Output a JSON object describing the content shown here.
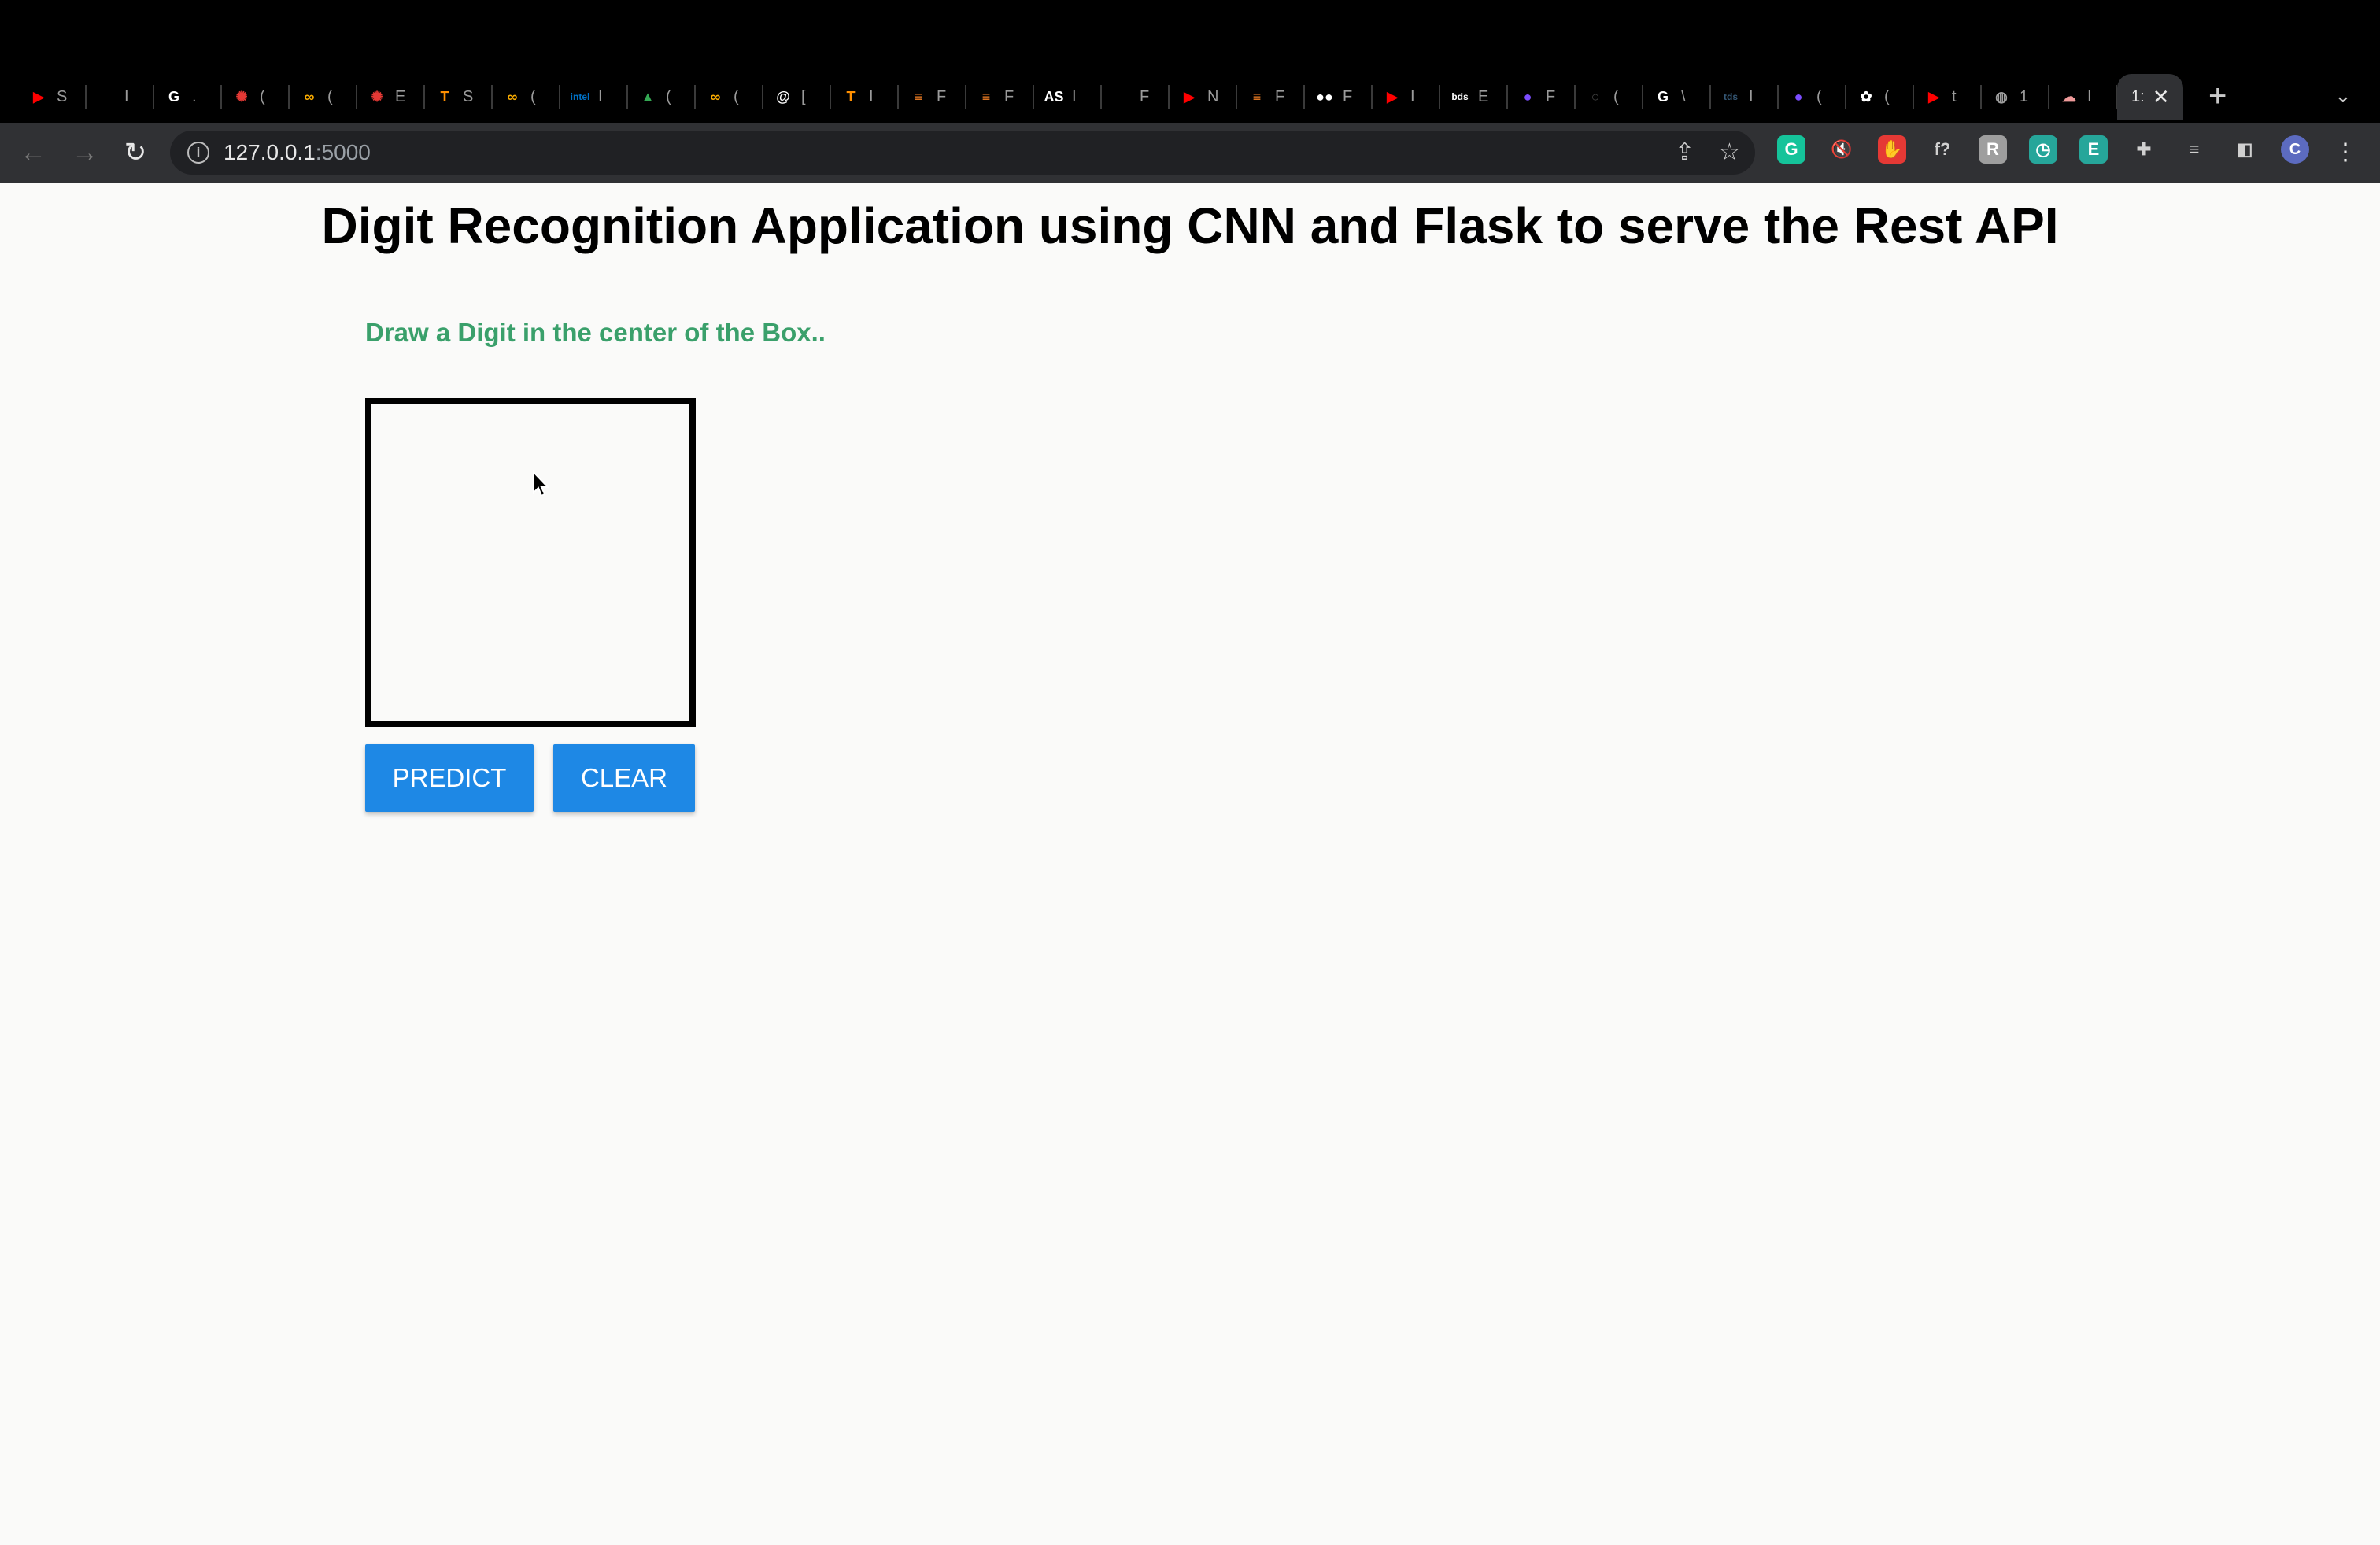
{
  "browser": {
    "tabs": [
      {
        "icon": "youtube-icon",
        "title": "S",
        "color": "#ff0000",
        "glyph": "▶"
      },
      {
        "icon": "github-icon",
        "title": "I",
        "color": "#000000",
        "glyph": "●"
      },
      {
        "icon": "google-icon",
        "title": ".",
        "color": "#ffffff",
        "glyph": "G"
      },
      {
        "icon": "sunburst-icon",
        "title": "(",
        "color": "#e53935",
        "glyph": "✺"
      },
      {
        "icon": "colab-icon",
        "title": "(",
        "color": "#f9ab00",
        "glyph": "∞"
      },
      {
        "icon": "sunburst-icon",
        "title": "E",
        "color": "#e53935",
        "glyph": "✺"
      },
      {
        "icon": "tensorflow-icon",
        "title": "S",
        "color": "#ff8f00",
        "glyph": "T"
      },
      {
        "icon": "colab-icon",
        "title": "(",
        "color": "#f9ab00",
        "glyph": "∞"
      },
      {
        "icon": "intel-icon",
        "title": "I",
        "color": "#0071c5",
        "glyph": "intel"
      },
      {
        "icon": "google-drive-icon",
        "title": "(",
        "color": "#34a853",
        "glyph": "▲"
      },
      {
        "icon": "colab-icon",
        "title": "(",
        "color": "#f9ab00",
        "glyph": "∞"
      },
      {
        "icon": "compass-icon",
        "title": "[",
        "color": "#ffffff",
        "glyph": "@"
      },
      {
        "icon": "tensorflow-icon",
        "title": "I",
        "color": "#ff8f00",
        "glyph": "T"
      },
      {
        "icon": "stackoverflow-icon",
        "title": "F",
        "color": "#f48024",
        "glyph": "≡"
      },
      {
        "icon": "stackoverflow-icon",
        "title": "F",
        "color": "#f48024",
        "glyph": "≡"
      },
      {
        "icon": "as-icon",
        "title": "I",
        "color": "#ffffff",
        "glyph": "AS"
      },
      {
        "icon": "github-icon",
        "title": "F",
        "color": "#000000",
        "glyph": "●"
      },
      {
        "icon": "youtube-icon",
        "title": "N",
        "color": "#ff0000",
        "glyph": "▶"
      },
      {
        "icon": "stackoverflow-icon",
        "title": "F",
        "color": "#f48024",
        "glyph": "≡"
      },
      {
        "icon": "medium-icon",
        "title": "F",
        "color": "#ffffff",
        "glyph": "●●"
      },
      {
        "icon": "youtube-icon",
        "title": "I",
        "color": "#ff0000",
        "glyph": "▶"
      },
      {
        "icon": "bds-icon",
        "title": "E",
        "color": "#ffffff",
        "glyph": "bds"
      },
      {
        "icon": "circle-icon",
        "title": "F",
        "color": "#7c4dff",
        "glyph": "●"
      },
      {
        "icon": "github-icon",
        "title": "(",
        "color": "#444444",
        "glyph": "○"
      },
      {
        "icon": "google-icon",
        "title": "\\",
        "color": "#ffffff",
        "glyph": "G"
      },
      {
        "icon": "tds-icon",
        "title": "I",
        "color": "#355876",
        "glyph": "tds"
      },
      {
        "icon": "circle-icon",
        "title": "(",
        "color": "#7c4dff",
        "glyph": "●"
      },
      {
        "icon": "app-icon",
        "title": "(",
        "color": "#ffffff",
        "glyph": "✿"
      },
      {
        "icon": "youtube-icon",
        "title": "t",
        "color": "#ff0000",
        "glyph": "▶"
      },
      {
        "icon": "globe-icon",
        "title": "1",
        "color": "#9e9e9e",
        "glyph": "◍"
      },
      {
        "icon": "cloud-icon",
        "title": "I",
        "color": "#ef9a9a",
        "glyph": "☁"
      }
    ],
    "active_tab": {
      "title": "1:",
      "close": "✕"
    },
    "new_tab": "+",
    "tab_list": "⌄",
    "url": "127.0.0.1",
    "url_port": ":5000",
    "extensions": [
      {
        "icon": "grammarly-icon",
        "color": "#15c39a",
        "glyph": "G"
      },
      {
        "icon": "mute-icon",
        "color": "transparent",
        "glyph": "🔇"
      },
      {
        "icon": "adblock-icon",
        "color": "#e53935",
        "glyph": "✋"
      },
      {
        "icon": "formula-icon",
        "color": "transparent",
        "glyph": "f?"
      },
      {
        "icon": "extension-r-icon",
        "color": "#9e9e9e",
        "glyph": "R"
      },
      {
        "icon": "extension-clock-icon",
        "color": "#26a69a",
        "glyph": "◷"
      },
      {
        "icon": "extension-e-icon",
        "color": "#26a69a",
        "glyph": "E"
      },
      {
        "icon": "puzzle-icon",
        "color": "transparent",
        "glyph": "✚"
      },
      {
        "icon": "media-icon",
        "color": "transparent",
        "glyph": "≡"
      },
      {
        "icon": "side-panel-icon",
        "color": "transparent",
        "glyph": "◧"
      }
    ],
    "profile": "C"
  },
  "page": {
    "title": "Digit Recognition Application using CNN and Flask to serve the Rest API",
    "instruction": "Draw a Digit in the center of the Box..",
    "instruction_color": "#3aa06b",
    "predict_label": "PREDICT",
    "clear_label": "CLEAR",
    "button_color": "#1e88e5"
  }
}
